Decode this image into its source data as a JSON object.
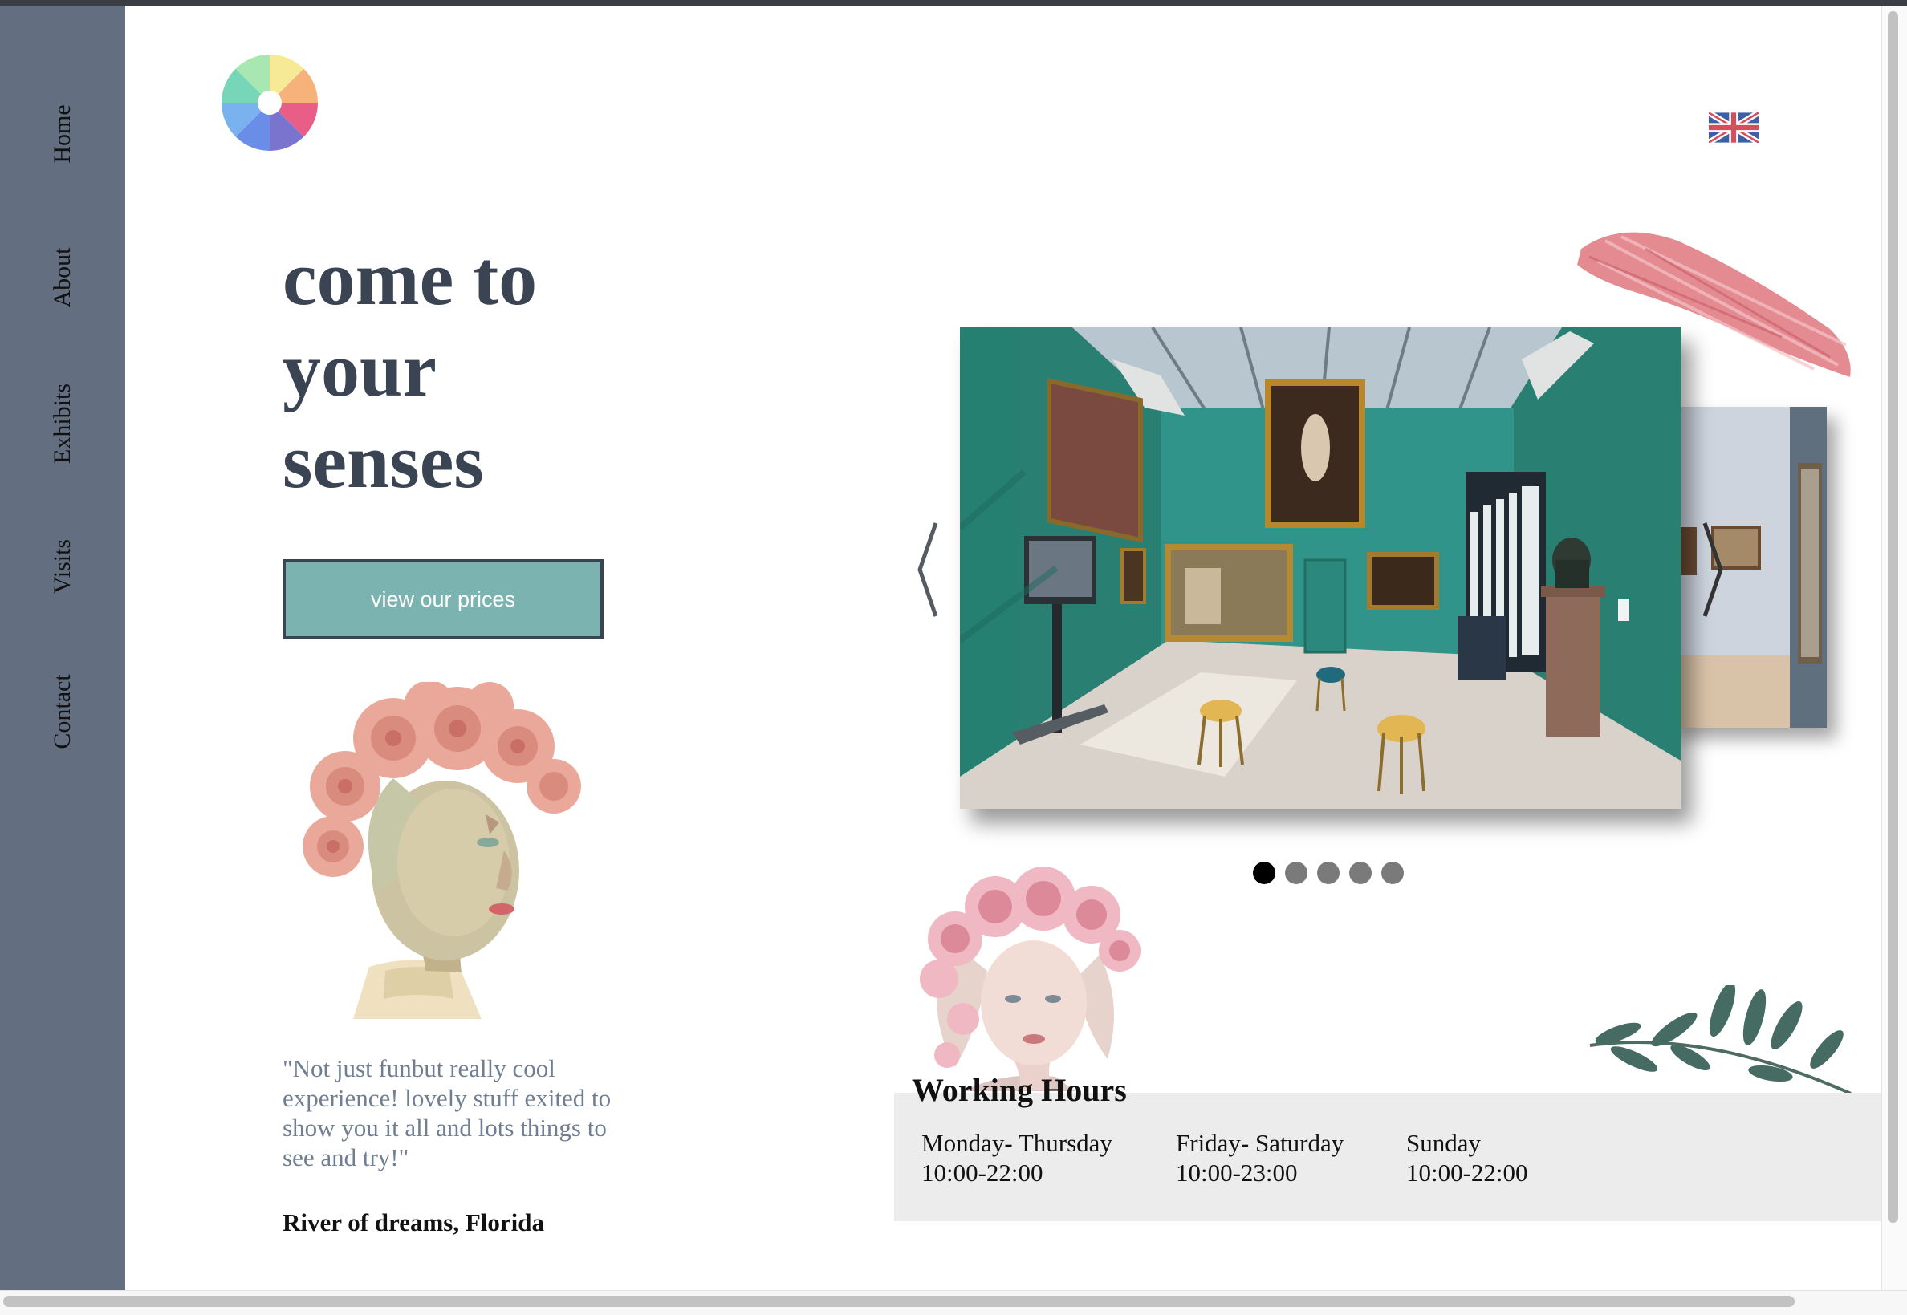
{
  "nav": {
    "items": [
      {
        "label": "Home"
      },
      {
        "label": "About"
      },
      {
        "label": "Exhibits"
      },
      {
        "label": "Visits"
      },
      {
        "label": "Contact"
      }
    ]
  },
  "header": {
    "logo_icon": "color-wheel-icon",
    "language_icon": "uk-flag-icon"
  },
  "hero": {
    "title_lines": [
      "come to",
      "your",
      "senses"
    ],
    "cta_label": "view our prices"
  },
  "testimonial": {
    "quote": "\"Not just funbut really cool experience! lovely stuff exited to show you it all and lots things to see and try!\"",
    "author": "River of dreams, Florida"
  },
  "carousel": {
    "prev_icon": "chevron-left-icon",
    "next_icon": "chevron-right-icon",
    "slide_count": 5,
    "active_index": 0
  },
  "hours": {
    "title": "Working Hours",
    "columns": [
      {
        "days": "Monday- Thursday",
        "time": "10:00-22:00"
      },
      {
        "days": "Friday- Saturday",
        "time": "10:00-23:00"
      },
      {
        "days": "Sunday",
        "time": "10:00-22:00"
      }
    ]
  },
  "colors": {
    "sidebar": "#636f80",
    "button": "#7bb3b0",
    "title": "#3a4452",
    "gallery_wall": "#2f8a7e",
    "brush_stroke": "#e07b83"
  }
}
